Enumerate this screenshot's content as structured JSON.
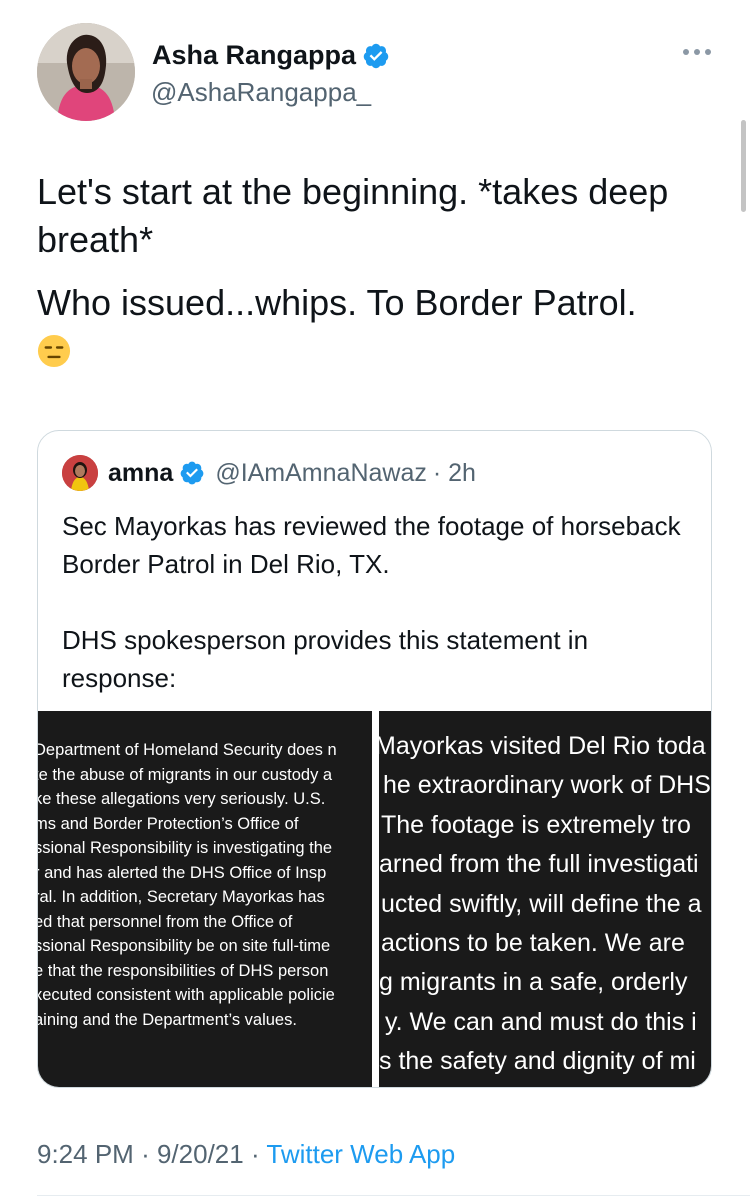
{
  "author": {
    "display_name": "Asha Rangappa",
    "handle": "@AshaRangappa_"
  },
  "tweet": {
    "paragraphs": [
      "Let's start at the beginning. *takes deep breath*",
      "Who issued...whips. To Border Patrol."
    ],
    "emoji": "expressionless-face-emoji"
  },
  "quoted": {
    "display_name": "amna",
    "handle": "@IAmAmnaNawaz",
    "time": "· 2h",
    "paragraphs": [
      "Sec Mayorkas has reviewed the footage of horseback Border Patrol in Del Rio, TX.",
      "DHS spokesperson provides this statement in response:"
    ],
    "image_left_lines": [
      "Department of Homeland Security does n",
      "te the abuse of migrants in our custody a",
      "ke these allegations very seriously. U.S.",
      "ms and Border Protection’s Office of",
      "ssional Responsibility is investigating the",
      "r and has alerted the DHS Office of Insp",
      "ral.  In addition, Secretary Mayorkas has",
      "ed that personnel from the Office of",
      "ssional Responsibility be on site full-time",
      "e that the responsibilities of DHS person",
      "xecuted consistent with applicable policie",
      "aining and the Department’s values."
    ],
    "image_right_lines": [
      "Mayorkas visited Del Rio toda",
      "he extraordinary work of DHS",
      "The footage is extremely tro",
      "arned from the full investigati",
      "ucted swiftly, will define the a",
      "actions to be taken. We are",
      "g migrants in a safe, orderly",
      "y. We can and must do this i",
      "s the safety and dignity of mi"
    ]
  },
  "footer": {
    "time": "9:24 PM",
    "date": "9/20/21",
    "sep": "·",
    "app": "Twitter Web App"
  },
  "colors": {
    "verified_blue": "#1d9bf0",
    "secondary_text": "#536471",
    "image_background": "#1a1a1a"
  }
}
